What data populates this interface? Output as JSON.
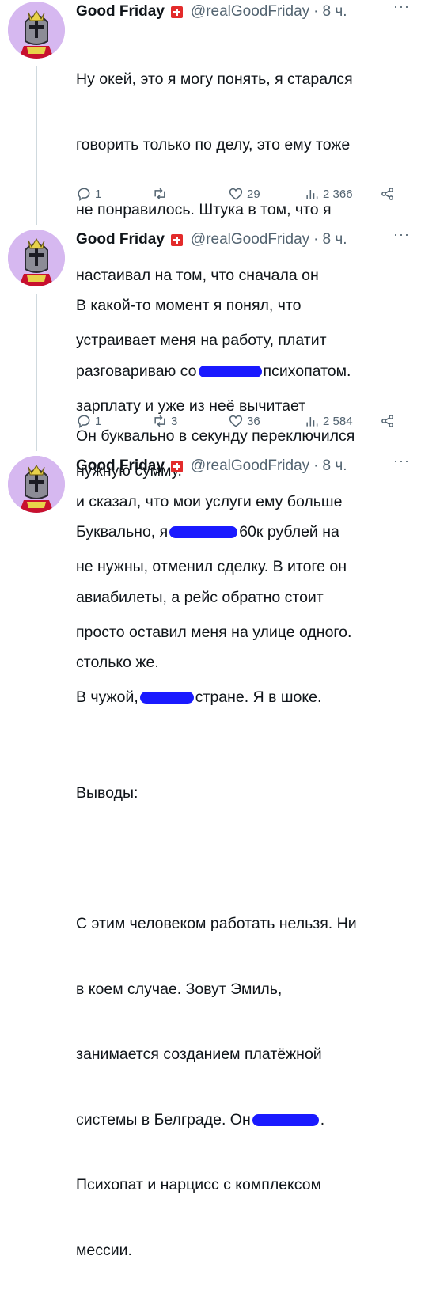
{
  "tweets": [
    {
      "name": "Good Friday",
      "handle": "@realGoodFriday",
      "dot": "·",
      "time": "8 ч.",
      "more": "···",
      "lines": [
        "Ну окей, это я могу понять, я старался",
        "говорить только по делу, это ему тоже",
        "не понравилось. Штука в том, что я",
        "настаивал на том, что сначала он",
        "устраивает меня на работу, платит",
        "зарплату и уже из неё вычитает",
        "нужную сумму."
      ],
      "replies": "1",
      "retweets": "",
      "likes": "29",
      "views": "2 366"
    },
    {
      "name": "Good Friday",
      "handle": "@realGoodFriday",
      "dot": "·",
      "time": "8 ч.",
      "more": "···",
      "l1": "В какой-то момент я понял, что",
      "l2a": "разговариваю со",
      "l2b": "психопатом.",
      "l3": "Он буквально в секунду переключился",
      "l4": "и сказал, что мои услуги ему больше",
      "l5": "не нужны, отменил сделку. В итоге он",
      "l6": "просто оставил меня на улице одного.",
      "l7a": "В чужой,",
      "l7b": "стране. Я в шоке.",
      "replies": "1",
      "retweets": "3",
      "likes": "36",
      "views": "2 584"
    },
    {
      "name": "Good Friday",
      "handle": "@realGoodFriday",
      "dot": "·",
      "time": "8 ч.",
      "more": "···",
      "l1a": "Буквально, я",
      "l1b": "60к рублей на",
      "l2": "авиабилеты, а рейс обратно стоит",
      "l3": "столько же.",
      "l5": "Выводы:",
      "l7": "С этим человеком работать нельзя. Ни",
      "l8": "в коем случае. Зовут Эмиль,",
      "l9": "занимается созданием платёжной",
      "l10a": "системы в Белграде. Он",
      "l10b": ".",
      "l11": "Психопат и нарцисс с комплексом",
      "l12": "мессии."
    }
  ],
  "colors": {
    "text": "#0f1419",
    "secondary": "#536471",
    "redaction": "#1a1aff",
    "flag": "#e32b2b",
    "avatar_bg": "#d6b8f0"
  },
  "icons": [
    "reply-icon",
    "retweet-icon",
    "like-icon",
    "views-icon",
    "share-icon",
    "swiss-flag-icon",
    "knight-helmet-avatar"
  ]
}
